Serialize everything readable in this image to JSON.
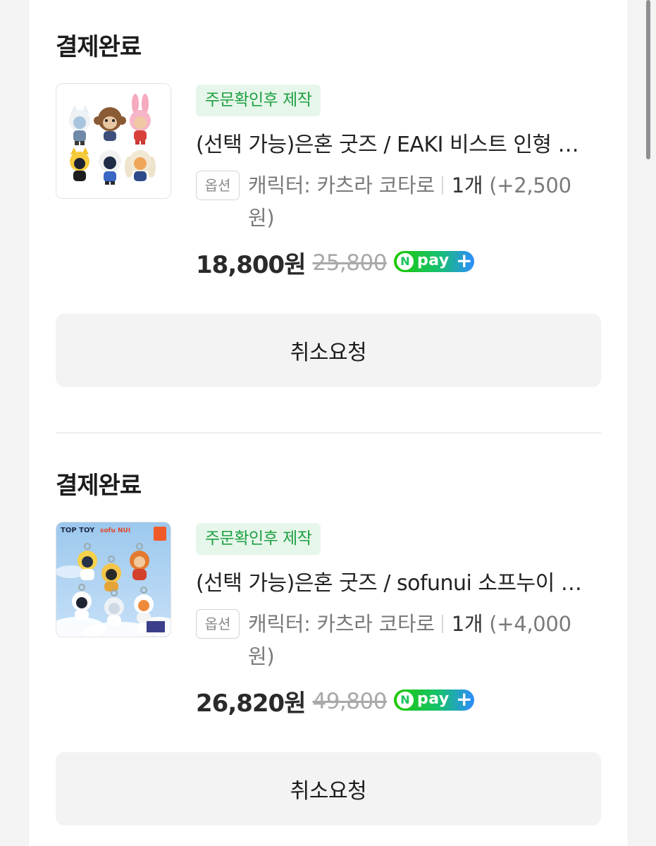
{
  "orders": [
    {
      "status": "결제완료",
      "tag": "주문확인후 제작",
      "product_name": "(선택 가능)은혼 굿즈 / EAKI 비스트 인형 키링",
      "option_label": "옵션",
      "option_value": "캐릭터: 카츠라 코타로",
      "quantity": "1개",
      "option_price": "(+2,500 원)",
      "price": "18,800원",
      "original_price": "25,800",
      "npay": "pay",
      "cancel_label": "취소요청"
    },
    {
      "status": "결제완료",
      "tag": "주문확인후 제작",
      "product_name": "(선택 가능)은혼 굿즈 / sofunui 소프누이 키링",
      "option_label": "옵션",
      "option_value": "캐릭터: 카츠라 코타로",
      "quantity": "1개",
      "option_price": "(+4,000 원)",
      "price": "26,820원",
      "original_price": "49,800",
      "npay": "pay",
      "cancel_label": "취소요청",
      "thumb_text": {
        "brand": "TOP TOY",
        "collab": "sofu NUI"
      }
    }
  ],
  "colors": {
    "tag_bg": "#e7f6ea",
    "tag_text": "#1ea043",
    "button_bg": "#f3f3f4",
    "npay_green": "#1ec800",
    "npay_blue": "#2d8cff"
  }
}
